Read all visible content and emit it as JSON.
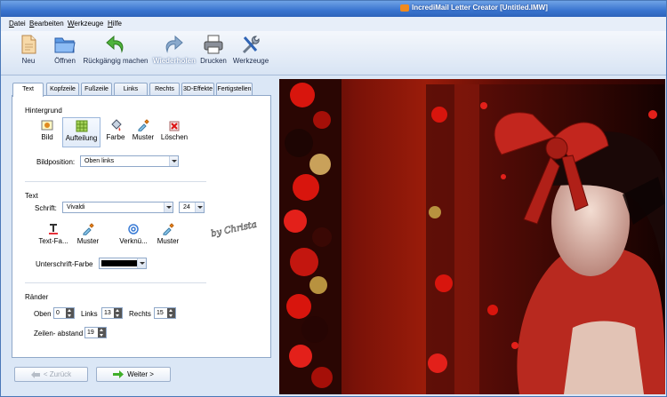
{
  "window": {
    "title": "IncrediMail Letter Creator [Untitled.IMW]",
    "app_icon": "incredimail-envelope-icon"
  },
  "menu": {
    "items": [
      {
        "label": "Datei"
      },
      {
        "label": "Bearbeiten"
      },
      {
        "label": "Werkzeuge"
      },
      {
        "label": "Hilfe"
      }
    ]
  },
  "toolbar": {
    "items": [
      {
        "label": "Neu",
        "icon": "new-document-icon"
      },
      {
        "label": "Öffnen",
        "icon": "open-folder-icon"
      },
      {
        "label": "Rückgängig machen",
        "icon": "undo-icon"
      },
      {
        "label": "Wiederholen",
        "icon": "redo-icon"
      },
      {
        "label": "Drucken",
        "icon": "printer-icon"
      },
      {
        "label": "Werkzeuge",
        "icon": "tools-icon"
      }
    ]
  },
  "tabs": [
    {
      "label": "Text",
      "active": true
    },
    {
      "label": "Kopfzeile",
      "active": false
    },
    {
      "label": "Fußzeile",
      "active": false
    },
    {
      "label": "Links",
      "active": false
    },
    {
      "label": "Rechts",
      "active": false
    },
    {
      "label": "3D-Effekte",
      "active": false
    },
    {
      "label": "Fertigstellen",
      "active": false
    }
  ],
  "background_section": {
    "title": "Hintergrund",
    "buttons": [
      {
        "label": "Bild",
        "icon": "picture-icon"
      },
      {
        "label": "Aufteilung",
        "icon": "grid-layout-icon",
        "selected": true
      },
      {
        "label": "Farbe",
        "icon": "paint-bucket-icon"
      },
      {
        "label": "Muster",
        "icon": "eyedropper-icon"
      },
      {
        "label": "Löschen",
        "icon": "delete-x-icon"
      }
    ],
    "position_label": "Bildposition:",
    "position_value": "Oben links"
  },
  "text_section": {
    "title": "Text",
    "font_label": "Schrift:",
    "font_value": "Vivaldi",
    "size_value": "24",
    "buttons": [
      {
        "label": "Text-Fa...",
        "icon": "text-color-icon"
      },
      {
        "label": "Muster",
        "icon": "eyedropper-icon"
      },
      {
        "label": "Verknü...",
        "icon": "link-at-icon"
      },
      {
        "label": "Muster",
        "icon": "eyedropper-icon"
      }
    ],
    "underline_color_label": "Unterschrift-Farbe",
    "underline_color": "#000000",
    "watermark_text": "by Christa"
  },
  "margins_section": {
    "title": "Ränder",
    "top_label": "Oben",
    "top_value": "0",
    "left_label": "Links",
    "left_value": "13",
    "right_label": "Rechts",
    "right_value": "15",
    "line_spacing_label": "Zeilen- abstand",
    "line_spacing_value": "19"
  },
  "navigation": {
    "back_label": "< Zurück",
    "next_label": "Weiter >"
  },
  "colors": {
    "title_bar": "#3a74cf",
    "panel_bg": "#dbe7f6",
    "preview_bg": "#7a1208",
    "rose_red": "#d8150d",
    "ribbon_red": "#c3261e"
  }
}
